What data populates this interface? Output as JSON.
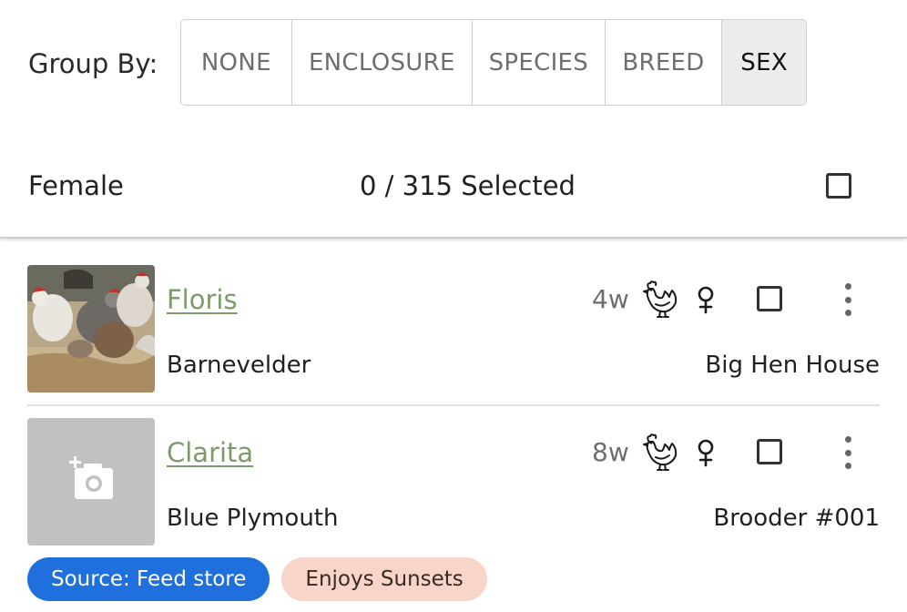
{
  "group_by": {
    "label": "Group By:",
    "options": [
      "NONE",
      "ENCLOSURE",
      "SPECIES",
      "BREED",
      "SEX"
    ],
    "selected": "SEX"
  },
  "group": {
    "title": "Female",
    "selection_text": "0 / 315 Selected",
    "select_all_checked": false
  },
  "animals": [
    {
      "name": "Floris",
      "breed": "Barnevelder",
      "location": "Big Hen House",
      "age": "4w",
      "species_icon": "chicken-icon",
      "sex_icon": "female-icon",
      "has_photo": true,
      "checked": false
    },
    {
      "name": "Clarita",
      "breed": "Blue Plymouth",
      "location": "Brooder #001",
      "age": "8w",
      "species_icon": "chicken-icon",
      "sex_icon": "female-icon",
      "has_photo": false,
      "photo_placeholder_icon": "add-photo-icon",
      "checked": false,
      "tags": [
        {
          "label": "Source: Feed store",
          "color": "#1f6fdc"
        },
        {
          "label": "Enjoys Sunsets",
          "color": "#f7d5c8"
        }
      ]
    }
  ],
  "colors": {
    "link": "#7c9a6a",
    "active_segment_bg": "#ececec",
    "tag_blue": "#1f6fdc",
    "tag_peach": "#f7d5c8"
  }
}
